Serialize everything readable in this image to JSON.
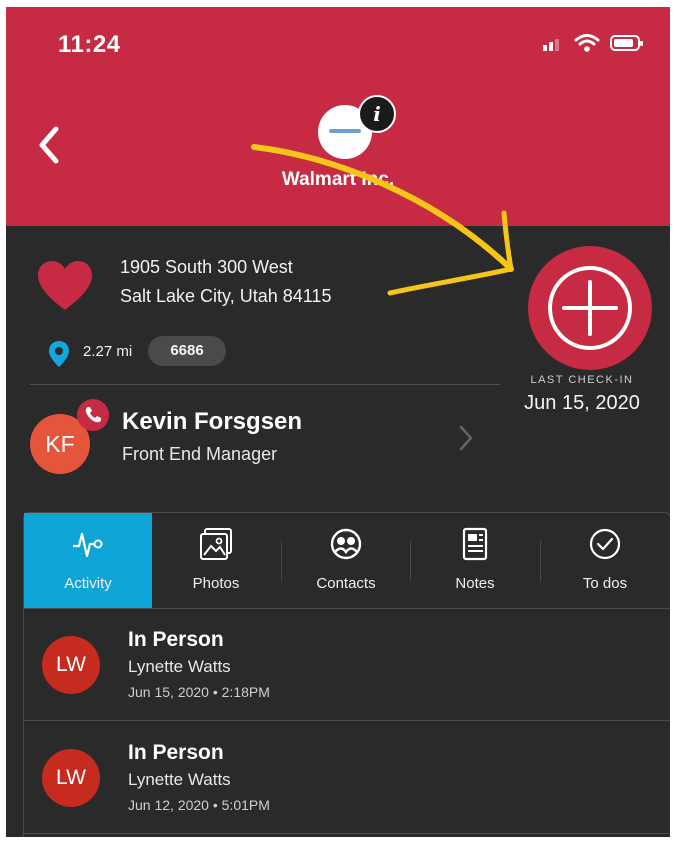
{
  "status_bar": {
    "time": "11:24"
  },
  "header": {
    "company_name": "Walmart Inc."
  },
  "store": {
    "address_line1": "1905 South 300 West",
    "address_line2": "Salt Lake City, Utah 84115",
    "distance": "2.27 mi",
    "store_number": "6686",
    "last_checkin_label": "LAST CHECK-IN",
    "last_checkin_date": "Jun 15, 2020"
  },
  "contact": {
    "initials": "KF",
    "name": "Kevin Forsgsen",
    "title": "Front End Manager"
  },
  "tabs": [
    {
      "label": "Activity",
      "icon": "activity-icon",
      "active": true
    },
    {
      "label": "Photos",
      "icon": "photos-icon"
    },
    {
      "label": "Contacts",
      "icon": "contacts-icon"
    },
    {
      "label": "Notes",
      "icon": "notes-icon"
    },
    {
      "label": "To dos",
      "icon": "check-circle-icon"
    }
  ],
  "activities": [
    {
      "initials": "LW",
      "type": "In Person",
      "person": "Lynette Watts",
      "datetime": "Jun 15, 2020 • 2:18PM"
    },
    {
      "initials": "LW",
      "type": "In Person",
      "person": "Lynette Watts",
      "datetime": "Jun 12, 2020 • 5:01PM"
    }
  ],
  "colors": {
    "brand_red": "#c72b44",
    "active_tab": "#0fa4d6",
    "background": "#2a2a2a",
    "annotation_arrow": "#f5c518"
  }
}
